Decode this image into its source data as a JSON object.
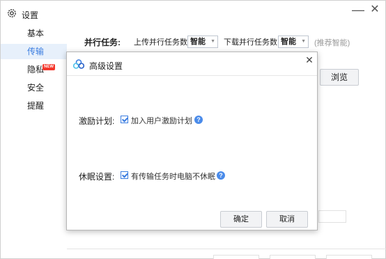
{
  "window": {
    "title": "设置",
    "minimize": "—",
    "close": "✕"
  },
  "sidebar": {
    "items": [
      {
        "label": "基本"
      },
      {
        "label": "传输"
      },
      {
        "label": "隐私",
        "badge": "NEW"
      },
      {
        "label": "安全"
      },
      {
        "label": "提醒"
      }
    ]
  },
  "main": {
    "parallel_label": "并行任务:",
    "upload_label": "上传并行任务数",
    "upload_value": "智能",
    "download_label": "下载并行任务数",
    "download_value": "智能",
    "recommend_hint": "(推荐智能)",
    "browse_button": "浏览"
  },
  "dialog": {
    "title": "高级设置",
    "close": "✕",
    "incentive_label": "激励计划:",
    "incentive_checkbox": "加入用户激励计划",
    "sleep_label": "休眠设置:",
    "sleep_checkbox": "有传输任务时电脑不休眠",
    "help_icon": "?",
    "confirm_button": "确定",
    "cancel_button": "取消"
  },
  "colors": {
    "accent": "#3b7de0",
    "active_bg": "#e7f0fb",
    "badge": "#f4372b",
    "help_icon": "#4a8bea"
  },
  "icons": [
    "gear-icon",
    "minimize-icon",
    "close-icon",
    "dropdown-arrow-icon",
    "cloud-logo-icon",
    "checkbox-icon",
    "help-icon"
  ]
}
